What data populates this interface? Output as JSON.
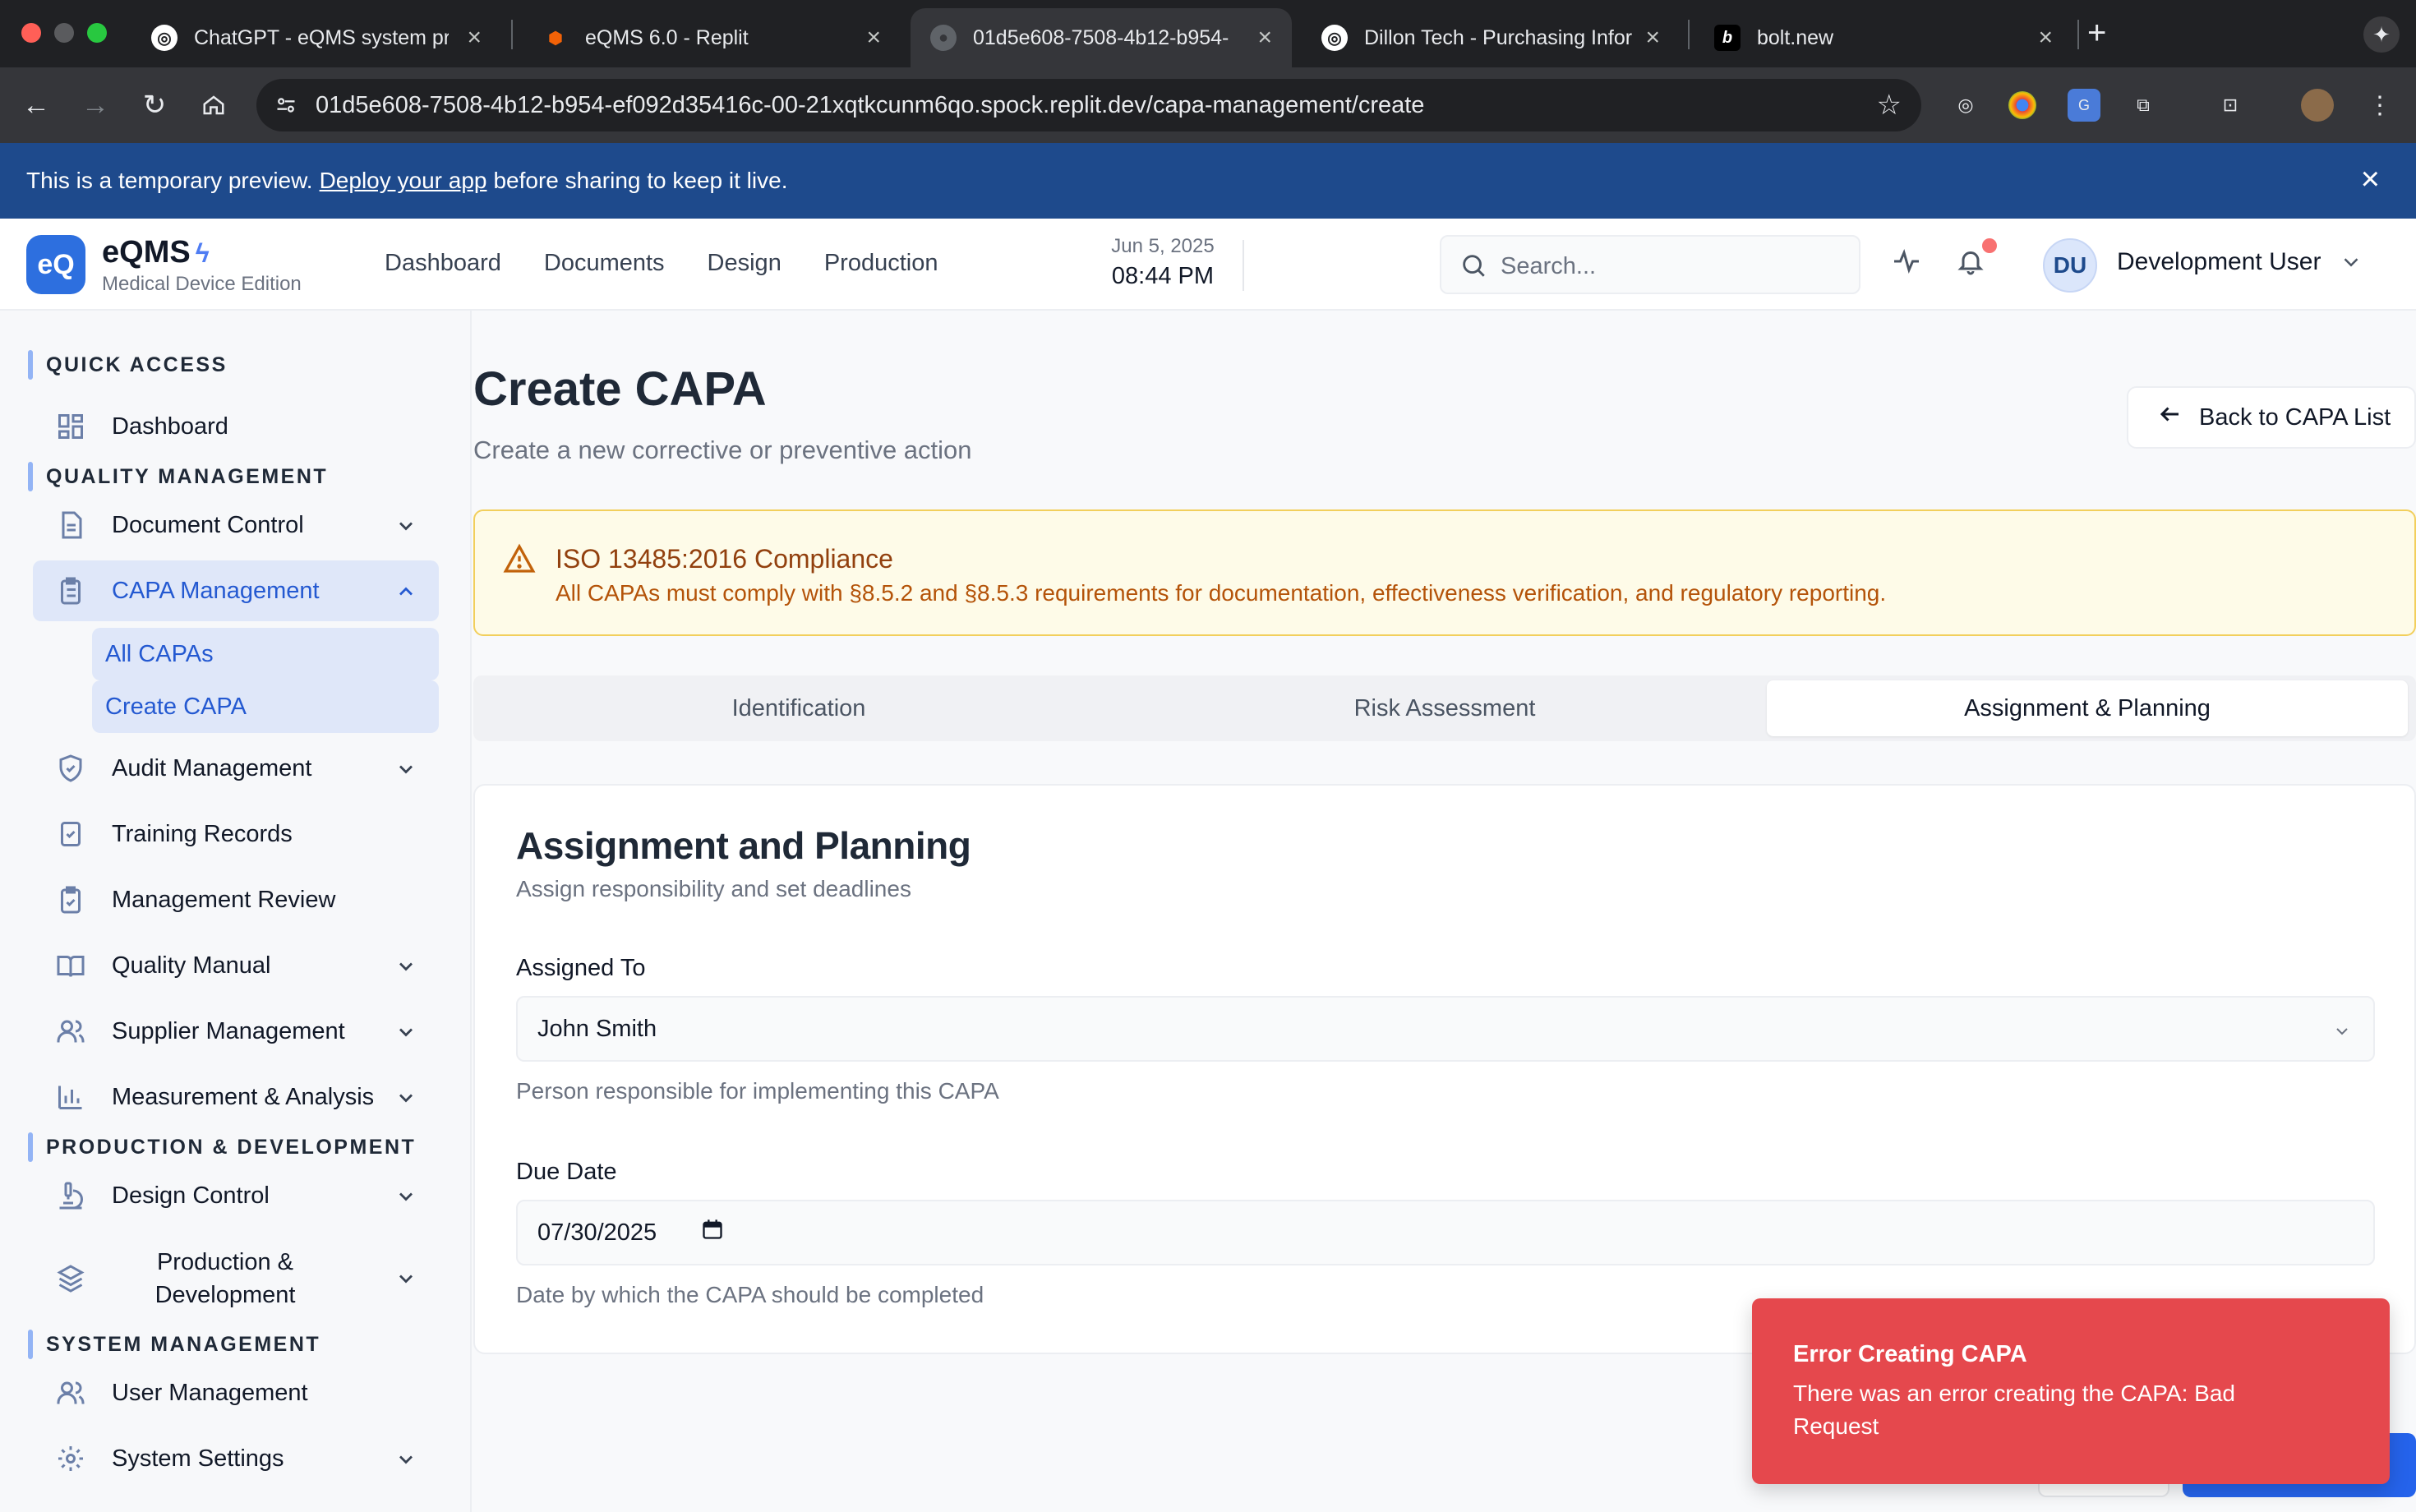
{
  "browser": {
    "tabs": [
      {
        "label": "ChatGPT - eQMS system pro",
        "favicon": "openai-icon"
      },
      {
        "label": "eQMS 6.0 - Replit",
        "favicon": "replit-icon"
      },
      {
        "label": "01d5e608-7508-4b12-b954-",
        "favicon": "globe-icon"
      },
      {
        "label": "Dillon Tech - Purchasing Infor",
        "favicon": "openai-icon"
      },
      {
        "label": "bolt.new",
        "favicon": "bolt-icon"
      }
    ],
    "url": "01d5e608-7508-4b12-b954-ef092d35416c-00-21xqtkcunm6qo.spock.replit.dev/capa-management/create"
  },
  "banner": {
    "text_before": "This is a temporary preview.",
    "link": "Deploy your app",
    "text_after": "before sharing to keep it live."
  },
  "header": {
    "logo": "eQ",
    "brand": "eQMS",
    "edition": "Medical Device Edition",
    "nav": [
      "Dashboard",
      "Documents",
      "Design",
      "Production"
    ],
    "date": "Jun 5, 2025",
    "time": "08:44 PM",
    "search_placeholder": "Search...",
    "avatar_initials": "DU",
    "user_name": "Development User"
  },
  "sidebar": {
    "sections": {
      "quick": "QUICK ACCESS",
      "quality": "QUALITY MANAGEMENT",
      "production": "PRODUCTION & DEVELOPMENT",
      "system": "SYSTEM MANAGEMENT"
    },
    "items": {
      "dashboard": "Dashboard",
      "document_control": "Document Control",
      "capa": "CAPA Management",
      "all_capas": "All CAPAs",
      "create_capa": "Create CAPA",
      "audit": "Audit Management",
      "training": "Training Records",
      "review": "Management Review",
      "manual": "Quality Manual",
      "supplier": "Supplier Management",
      "measurement": "Measurement & Analysis",
      "design": "Design Control",
      "production_line1": "Production &",
      "production_line2": "Development",
      "users": "User Management",
      "settings": "System Settings"
    }
  },
  "page": {
    "title": "Create CAPA",
    "subtitle": "Create a new corrective or preventive action",
    "back_button": "Back to CAPA List",
    "alert": {
      "title": "ISO 13485:2016 Compliance",
      "text": "All CAPAs must comply with §8.5.2 and §8.5.3 requirements for documentation, effectiveness verification, and regulatory reporting."
    },
    "tabs": [
      "Identification",
      "Risk Assessment",
      "Assignment & Planning"
    ],
    "active_tab": "Assignment & Planning",
    "card": {
      "title": "Assignment and Planning",
      "subtitle": "Assign responsibility and set deadlines",
      "assigned_label": "Assigned To",
      "assigned_value": "John Smith",
      "assigned_help": "Person responsible for implementing this CAPA",
      "due_label": "Due Date",
      "due_value": "07/30/2025",
      "due_help": "Date by which the CAPA should be completed"
    }
  },
  "toast": {
    "title": "Error Creating CAPA",
    "message": "There was an error creating the CAPA: Bad Request"
  },
  "colors": {
    "brand_blue": "#2d6fdf",
    "banner_blue": "#1e4a8c",
    "active_nav": "#2459d1",
    "alert_bg": "#fefbe8",
    "toast_red": "#e5484d"
  }
}
